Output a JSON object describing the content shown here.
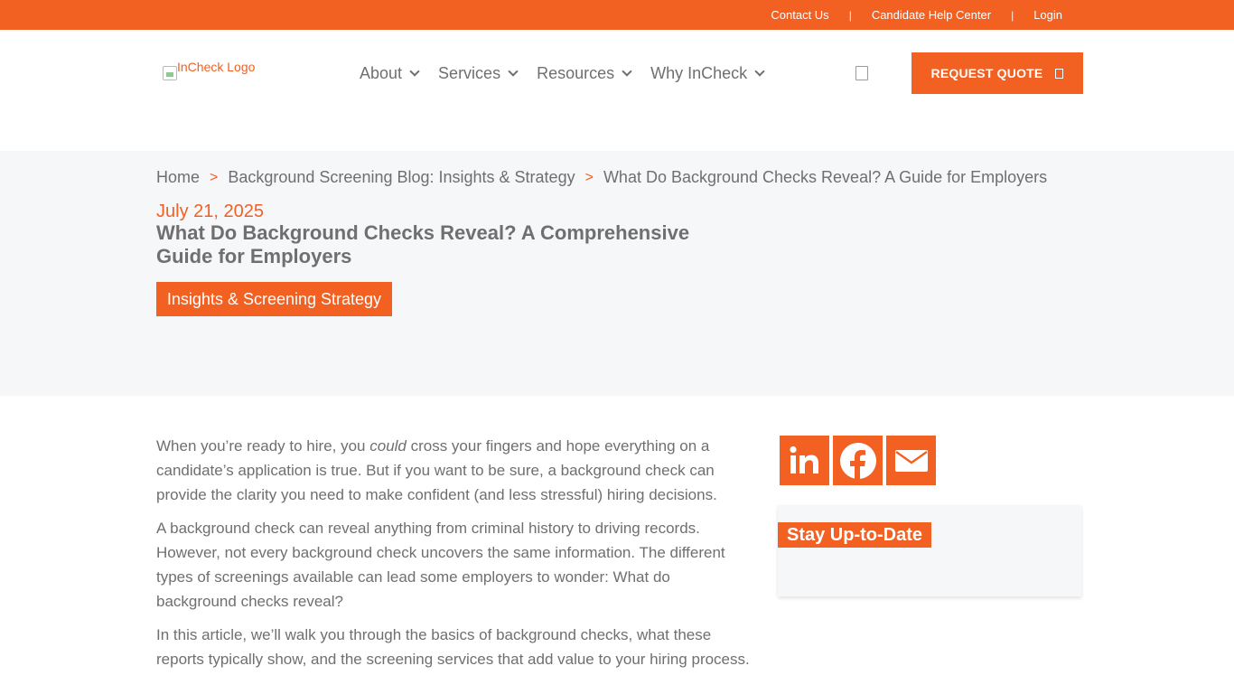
{
  "topbar": {
    "links": [
      "Contact Us",
      "Candidate Help Center",
      "Login"
    ]
  },
  "header": {
    "logo_alt": "InCheck Logo",
    "nav": [
      "About",
      "Services",
      "Resources",
      "Why InCheck"
    ],
    "quote_button": "REQUEST QUOTE"
  },
  "hero": {
    "breadcrumb": {
      "home": "Home",
      "blog": "Background Screening Blog: Insights & Strategy",
      "current": "What Do Background Checks Reveal? A Guide for Employers",
      "separator": ">"
    },
    "date": "July 21, 2025",
    "title": "What Do Background Checks Reveal? A Comprehensive Guide for Employers",
    "category": "Insights & Screening Strategy"
  },
  "article": {
    "p1_a": "When you’re ready to hire, you ",
    "p1_em": "could",
    "p1_b": " cross your fingers and hope everything on a candidate’s application is true. But if you want to be sure, a background check can provide the clarity you need to make confident (and less stressful) hiring decisions.",
    "p2": "A background check can reveal anything from criminal history to driving records. However, not every background check uncovers the same information. The different types of screenings available can lead some employers to wonder: What do background checks reveal?",
    "p3": "In this article, we’ll walk you through the basics of background checks, what these reports typically show, and the screening services that add value to your hiring process."
  },
  "sidebar": {
    "share_icons": [
      "linkedin-icon",
      "facebook-icon",
      "email-icon"
    ],
    "subscribe_title": "Stay Up-to-Date"
  },
  "colors": {
    "brand_orange": "#f26022",
    "text_gray": "#6f6f6f",
    "hero_bg": "#f5f7f9"
  }
}
